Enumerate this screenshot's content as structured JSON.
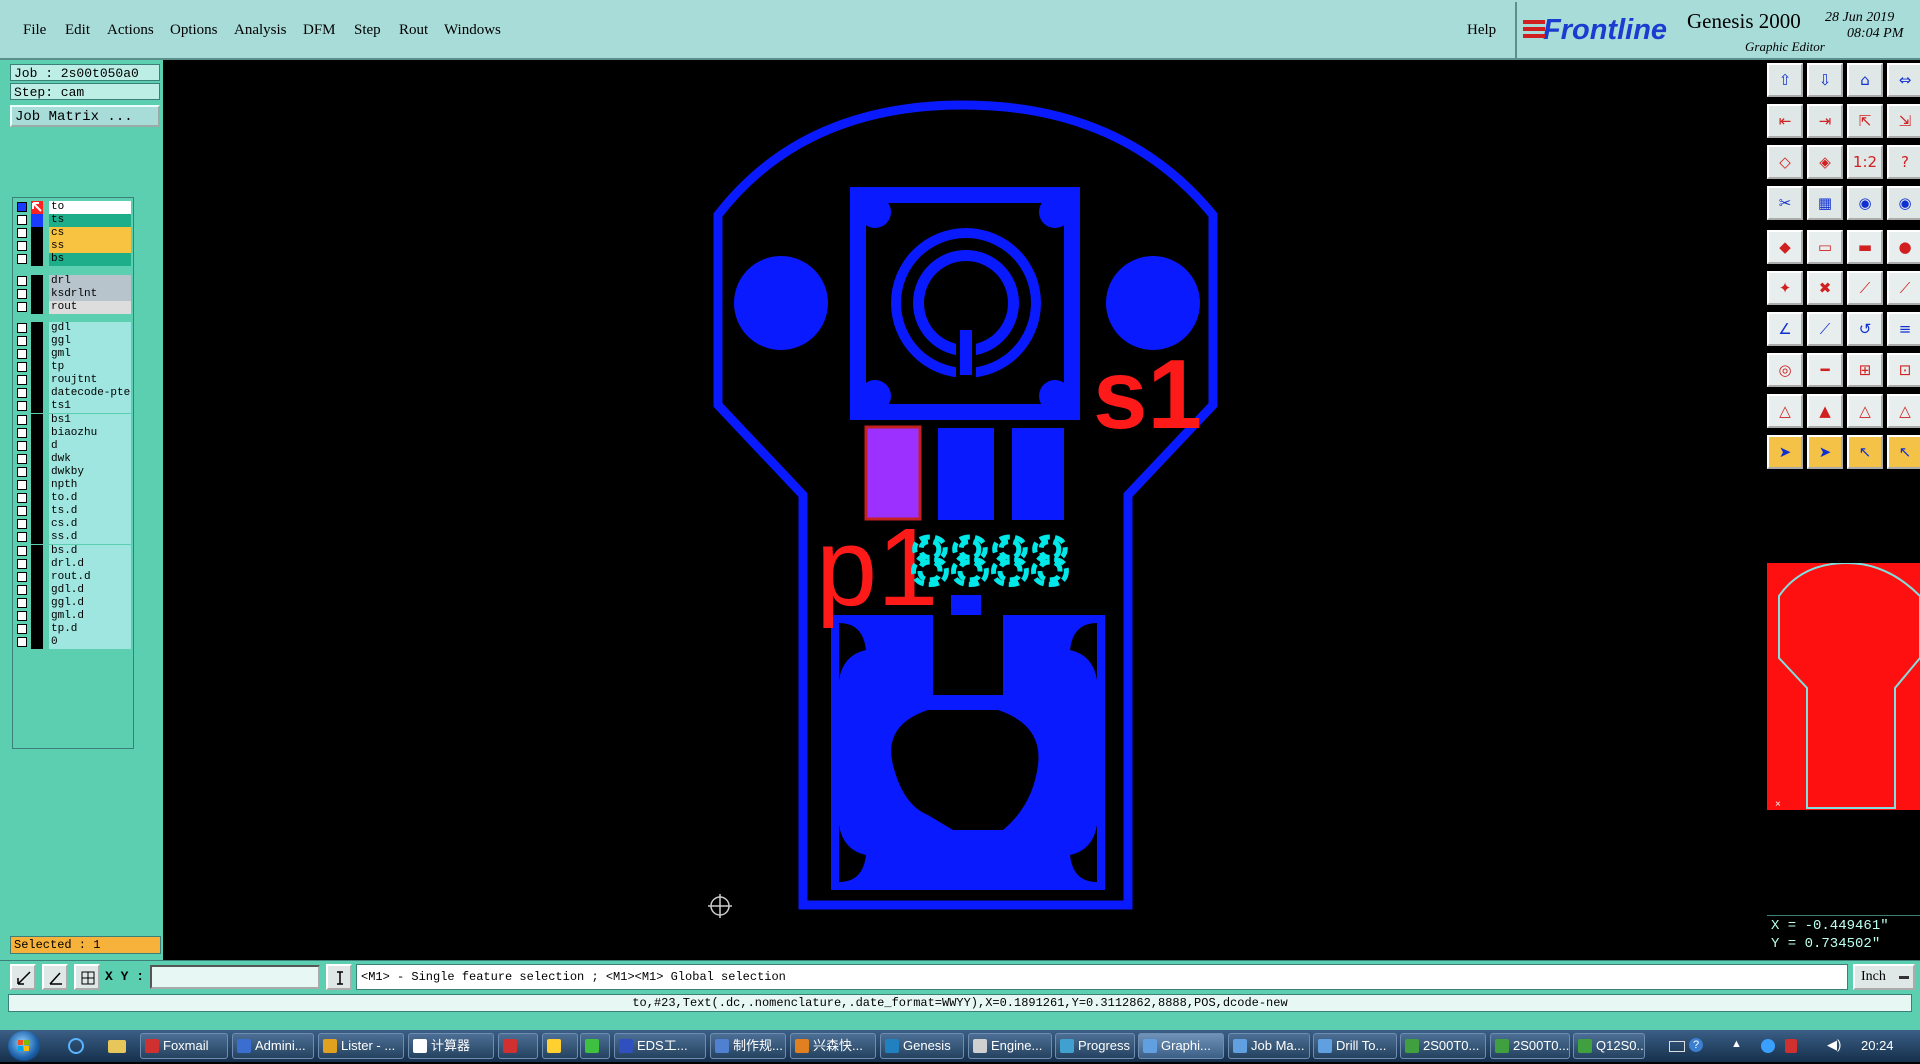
{
  "menu": {
    "items": [
      "File",
      "Edit",
      "Actions",
      "Options",
      "Analysis",
      "DFM",
      "Step",
      "Rout",
      "Windows"
    ],
    "help": "Help"
  },
  "brand": {
    "logo": "Frontline",
    "product": "Genesis 2000",
    "subtitle": "Graphic Editor",
    "date": "28 Jun 2019",
    "time": "08:04 PM"
  },
  "job": {
    "job_label": "Job : 2s00t050a0",
    "step_label": "Step: cam",
    "matrix_button": "Job Matrix ..."
  },
  "layers": [
    {
      "name": "to",
      "color": "#ffffff",
      "swatch": "#1a3cff",
      "state": "work"
    },
    {
      "name": "ts",
      "color": "#1fae8a",
      "swatch": "#1a3cff"
    },
    {
      "name": "cs",
      "color": "#f7c341",
      "swatch": "#000000"
    },
    {
      "name": "ss",
      "color": "#f7c341",
      "swatch": "#000000"
    },
    {
      "name": "bs",
      "color": "#1fae8a",
      "swatch": "#000000"
    },
    {
      "name": "drl",
      "color": "#b7c4cc",
      "swatch": "#000000"
    },
    {
      "name": "ksdrlnt",
      "color": "#b7c4cc",
      "swatch": "#000000"
    },
    {
      "name": "rout",
      "color": "#dddddd",
      "swatch": "#000000"
    },
    {
      "name": "gdl",
      "color": "#9ee6df",
      "swatch": "#000000"
    },
    {
      "name": "ggl",
      "color": "#9ee6df",
      "swatch": "#000000"
    },
    {
      "name": "gml",
      "color": "#9ee6df",
      "swatch": "#000000"
    },
    {
      "name": "tp",
      "color": "#9ee6df",
      "swatch": "#000000"
    },
    {
      "name": "roujtnt",
      "color": "#9ee6df",
      "swatch": "#000000"
    },
    {
      "name": "datecode-pte",
      "color": "#9ee6df",
      "swatch": "#000000"
    },
    {
      "name": "ts1",
      "color": "#9ee6df",
      "swatch": "#000000"
    },
    {
      "name": "bs1",
      "color": "#9ee6df",
      "swatch": "#000000"
    },
    {
      "name": "biaozhu",
      "color": "#9ee6df",
      "swatch": "#000000"
    },
    {
      "name": "d",
      "color": "#9ee6df",
      "swatch": "#000000"
    },
    {
      "name": "dwk",
      "color": "#9ee6df",
      "swatch": "#000000"
    },
    {
      "name": "dwkby",
      "color": "#9ee6df",
      "swatch": "#000000"
    },
    {
      "name": "npth",
      "color": "#9ee6df",
      "swatch": "#000000"
    },
    {
      "name": "to.d",
      "color": "#9ee6df",
      "swatch": "#000000"
    },
    {
      "name": "ts.d",
      "color": "#9ee6df",
      "swatch": "#000000"
    },
    {
      "name": "cs.d",
      "color": "#9ee6df",
      "swatch": "#000000"
    },
    {
      "name": "ss.d",
      "color": "#9ee6df",
      "swatch": "#000000"
    },
    {
      "name": "bs.d",
      "color": "#9ee6df",
      "swatch": "#000000"
    },
    {
      "name": "drl.d",
      "color": "#9ee6df",
      "swatch": "#000000"
    },
    {
      "name": "rout.d",
      "color": "#9ee6df",
      "swatch": "#000000"
    },
    {
      "name": "gdl.d",
      "color": "#9ee6df",
      "swatch": "#000000"
    },
    {
      "name": "ggl.d",
      "color": "#9ee6df",
      "swatch": "#000000"
    },
    {
      "name": "gml.d",
      "color": "#9ee6df",
      "swatch": "#000000"
    },
    {
      "name": "tp.d",
      "color": "#9ee6df",
      "swatch": "#000000"
    },
    {
      "name": "0",
      "color": "#9ee6df",
      "swatch": "#000000"
    }
  ],
  "status": {
    "selected": "Selected : 1",
    "xy_label": "X Y :",
    "xy_value": "",
    "prompt": "<M1> - Single feature selection ; <M1><M1> Global selection",
    "units": "Inch",
    "x_readout": "X = -0.449461\"",
    "y_readout": "Y = 0.734502\"",
    "feature_info": "to,#23,Text(.dc,.nomenclature,.date_format=WWYY),X=0.1891261,Y=0.3112862,8888,POS,dcode-new"
  },
  "canvas": {
    "label_s1": "s1",
    "label_p1": "p1",
    "datecode": "8888"
  },
  "taskbar": {
    "tasks": [
      "Foxmail",
      "Admini...",
      "Lister - ...",
      "计算器",
      "",
      "",
      "",
      "EDS工...",
      "制作规...",
      "兴森快...",
      "Genesis",
      "Engine...",
      "Progress",
      "Graphi...",
      "Job Ma...",
      "Drill To...",
      "2S00T0...",
      "2S00T0...",
      "Q12S0..."
    ],
    "clock": "20:24"
  },
  "colors": {
    "copper": "#0a1aff",
    "silk": "#ff1a1a",
    "datecode": "#00e8e8",
    "selected_pad": "#9b30ff",
    "panel": "#5ccfb0"
  }
}
